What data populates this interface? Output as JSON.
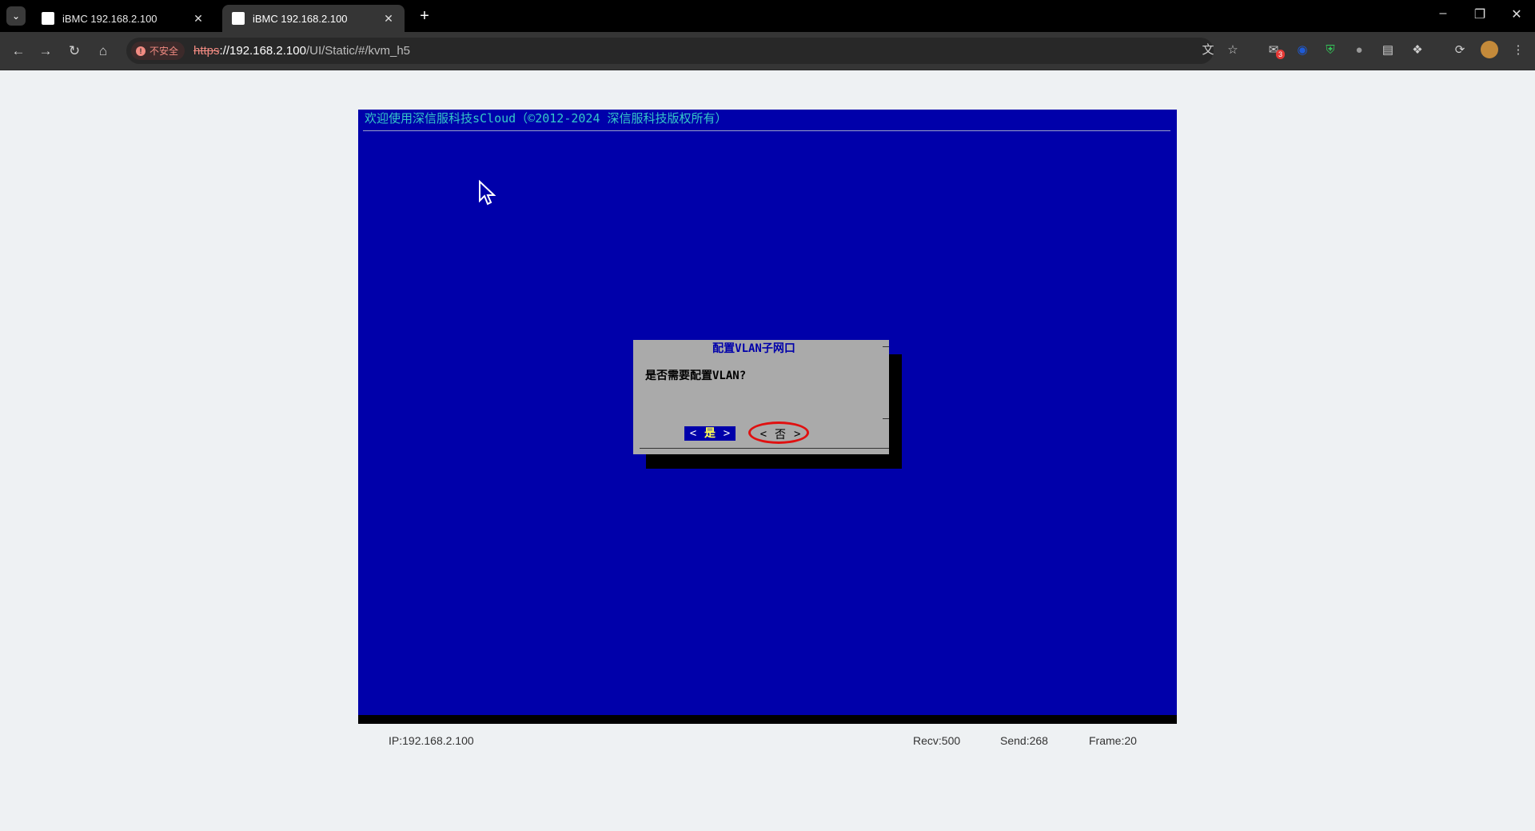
{
  "browser": {
    "tabs": [
      {
        "title": "iBMC 192.168.2.100",
        "active": false
      },
      {
        "title": "iBMC 192.168.2.100",
        "active": true
      }
    ],
    "new_tab_glyph": "+",
    "address": {
      "security_label": "不安全",
      "scheme": "https",
      "host_part": "://192.168.2.100",
      "path": "/UI/Static/#/kvm_h5"
    },
    "extension_badge": "3"
  },
  "console": {
    "banner": "欢迎使用深信服科技sCloud（©2012-2024 深信服科技版权所有）",
    "colors": {
      "background": "#0000aa",
      "banner_text": "#35c8c8",
      "dialog": "#aaaaaa",
      "highlight": "#e01010"
    }
  },
  "dialog": {
    "title": "配置VLAN子网口",
    "message": "是否需要配置VLAN?",
    "yes": {
      "left": "<",
      "label": "是",
      "right": ">"
    },
    "no": {
      "left": "<",
      "label": "否",
      "right": ">"
    }
  },
  "status": {
    "ip": "IP:192.168.2.100",
    "recv": "Recv:500",
    "send": "Send:268",
    "frame": "Frame:20"
  }
}
